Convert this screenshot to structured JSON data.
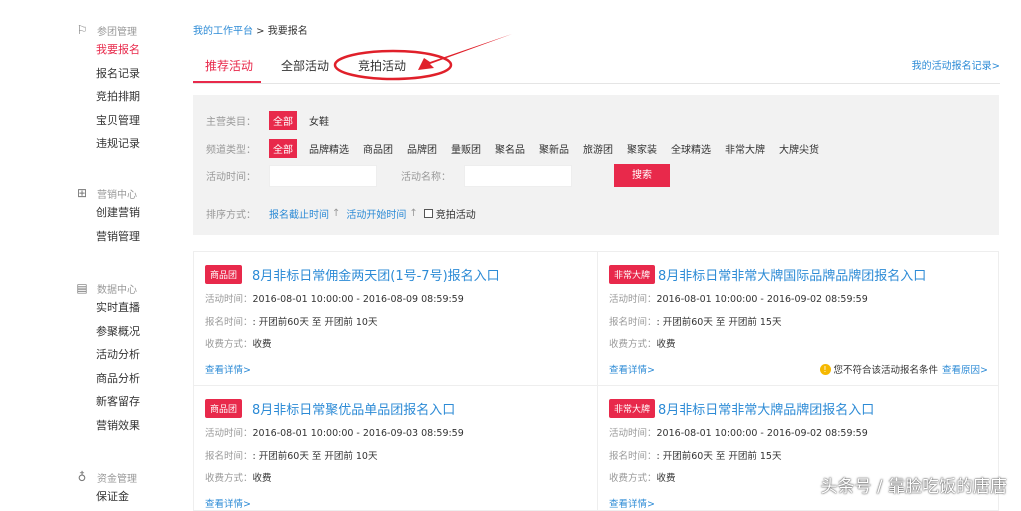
{
  "sidebar": {
    "groups": [
      {
        "title": "参团管理",
        "icon": "flag-icon",
        "items": [
          "我要报名",
          "报名记录",
          "竞拍排期",
          "宝贝管理",
          "违规记录"
        ]
      },
      {
        "title": "营销中心",
        "icon": "gift-icon",
        "items": [
          "创建营销",
          "营销管理"
        ]
      },
      {
        "title": "数据中心",
        "icon": "chart-icon",
        "items": [
          "实时直播",
          "参聚概况",
          "活动分析",
          "商品分析",
          "新客留存",
          "营销效果"
        ]
      },
      {
        "title": "资金管理",
        "icon": "money-bag-icon",
        "items": [
          "保证金"
        ]
      }
    ]
  },
  "breadcrumb": {
    "home": "我的工作平台",
    "sep": " > ",
    "current": "我要报名"
  },
  "tabs": [
    "推荐活动",
    "全部活动",
    "竞拍活动"
  ],
  "record_link": "我的活动报名记录>",
  "filter": {
    "category_label": "主营类目：",
    "categories": [
      "全部",
      "女鞋"
    ],
    "channel_label": "频道类型：",
    "channels": [
      "全部",
      "品牌精选",
      "商品团",
      "品牌团",
      "量贩团",
      "聚名品",
      "聚新品",
      "旅游团",
      "聚家装",
      "全球精选",
      "非常大牌",
      "大牌尖货"
    ],
    "time_label": "活动时间：",
    "time_value": "",
    "name_label": "活动名称：",
    "name_value": "",
    "search": "搜索",
    "sort_label": "排序方式：",
    "sort1": "报名截止时间",
    "sort2": "活动开始时间",
    "arrow": "↑",
    "auction_checkbox": "竞拍活动"
  },
  "cards": [
    {
      "tag": "商品团",
      "title": "8月非标日常佣金两天团(1号-7号)报名入口",
      "time": "2016-08-01 10:00:00 - 2016-08-09 08:59:59",
      "signup": ": 开团前60天 至 开团前 10天",
      "fee": "收费",
      "detail": "查看详情>"
    },
    {
      "tag": "非常大牌",
      "title": "8月非标日常非常大牌国际品牌品牌团报名入口",
      "time": "2016-08-01 10:00:00 - 2016-09-02 08:59:59",
      "signup": ": 开团前60天 至 开团前 15天",
      "fee": "收费",
      "detail": "查看详情>",
      "warning": "您不符合该活动报名条件",
      "reason": "查看原因>"
    },
    {
      "tag": "商品团",
      "title": "8月非标日常聚优品单品团报名入口",
      "time": "2016-08-01 10:00:00 - 2016-09-03 08:59:59",
      "signup": ": 开团前60天 至 开团前 10天",
      "fee": "收费",
      "detail": "查看详情>"
    },
    {
      "tag": "非常大牌",
      "title": "8月非标日常非常大牌品牌团报名入口",
      "time": "2016-08-01 10:00:00 - 2016-09-02 08:59:59",
      "signup": ": 开团前60天 至 开团前 15天",
      "fee": "收费",
      "detail": "查看详情>"
    }
  ],
  "labels": {
    "time": "活动时间：",
    "signup": "报名时间：",
    "fee": "收费方式："
  },
  "watermark": "头条号 / 靠脸吃饭的唐唐",
  "colors": {
    "accent": "#e8294b",
    "link": "#2d8bd6",
    "annotation": "#e0202a"
  }
}
